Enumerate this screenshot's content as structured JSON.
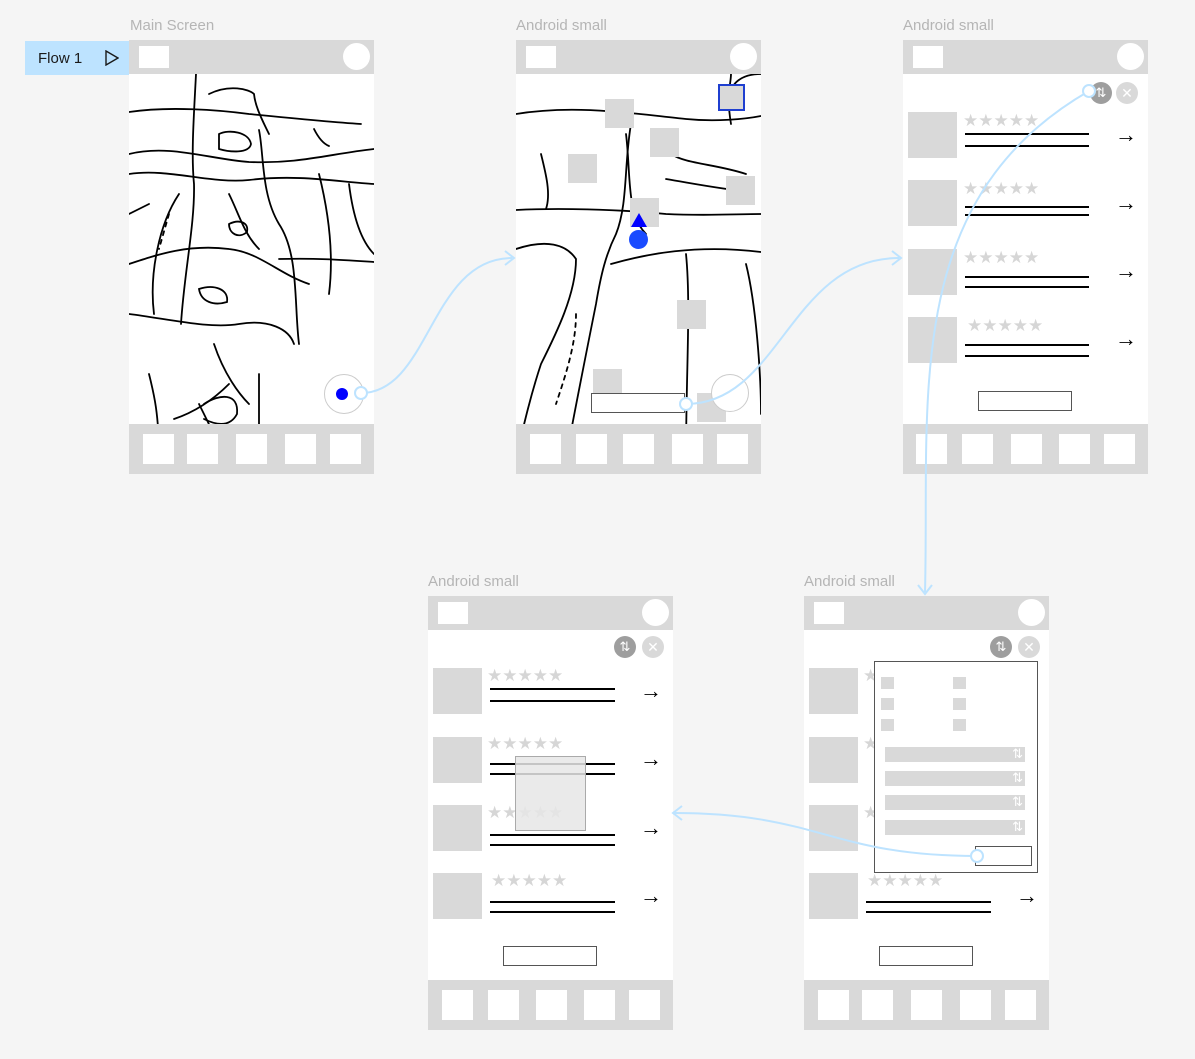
{
  "flow": {
    "label": "Flow 1"
  },
  "frames": [
    {
      "id": "f1",
      "title": "Main Screen"
    },
    {
      "id": "f2",
      "title": "Android small"
    },
    {
      "id": "f3",
      "title": "Android small"
    },
    {
      "id": "f4",
      "title": "Android small"
    },
    {
      "id": "f5",
      "title": "Android small"
    }
  ],
  "list": {
    "stars": "★★★★★",
    "arrow": "→",
    "sort_glyph": "⇅",
    "close_glyph": "✕"
  },
  "colors": {
    "accent": "#0000ff",
    "connector": "#bde3ff",
    "placeholder": "#d9d9d9"
  },
  "icons": {
    "play": "play-icon",
    "location": "location-icon",
    "sort": "sort-icon",
    "close": "close-icon",
    "arrow": "arrow-right-icon"
  }
}
